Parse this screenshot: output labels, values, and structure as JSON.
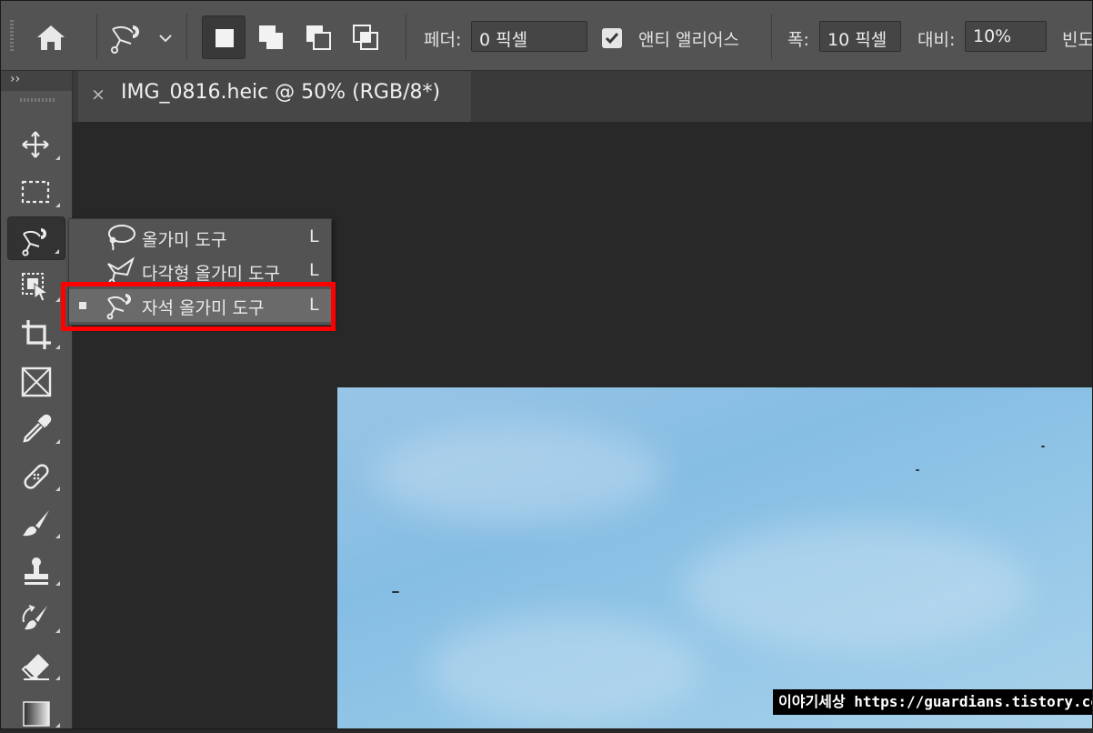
{
  "options_bar": {
    "feather_label": "페더:",
    "feather_value": "0 픽셀",
    "antialias_label": "앤티 앨리어스",
    "antialias_checked": true,
    "width_label": "폭:",
    "width_value": "10 픽셀",
    "contrast_label": "대비:",
    "contrast_value": "10%",
    "frequency_label": "빈도"
  },
  "toolbar": {
    "collapse_glyph": "››",
    "tools": [
      {
        "name": "move-tool",
        "icon": "move-icon"
      },
      {
        "name": "marquee-tool",
        "icon": "rect-marquee-icon"
      },
      {
        "name": "lasso-tool",
        "icon": "magnetic-lasso-icon",
        "active": true
      },
      {
        "name": "object-selection-tool",
        "icon": "object-selection-icon"
      },
      {
        "name": "crop-tool",
        "icon": "crop-icon"
      },
      {
        "name": "frame-tool",
        "icon": "frame-icon"
      },
      {
        "name": "eyedropper-tool",
        "icon": "eyedropper-icon"
      },
      {
        "name": "healing-brush-tool",
        "icon": "bandage-icon"
      },
      {
        "name": "brush-tool",
        "icon": "brush-icon"
      },
      {
        "name": "clone-stamp-tool",
        "icon": "stamp-icon"
      },
      {
        "name": "history-brush-tool",
        "icon": "history-brush-icon"
      },
      {
        "name": "eraser-tool",
        "icon": "eraser-icon"
      },
      {
        "name": "gradient-tool",
        "icon": "gradient-icon"
      }
    ]
  },
  "document_tab": {
    "close_glyph": "×",
    "title": "IMG_0816.heic @ 50% (RGB/8*)"
  },
  "flyout_menu": {
    "items": [
      {
        "label": "올가미 도구",
        "shortcut": "L",
        "icon": "lasso-icon",
        "selected": false
      },
      {
        "label": "다각형 올가미 도구",
        "shortcut": "L",
        "icon": "polygonal-lasso-icon",
        "selected": false
      },
      {
        "label": "자석 올가미 도구",
        "shortcut": "L",
        "icon": "magnetic-lasso-icon",
        "selected": true
      }
    ]
  },
  "watermark": "이야기세상 https://guardians.tistory.com",
  "colors": {
    "ui_panel": "#535353",
    "canvas_bg": "#282828",
    "highlight": "#ff0000",
    "sky": "#8ec2e5"
  }
}
